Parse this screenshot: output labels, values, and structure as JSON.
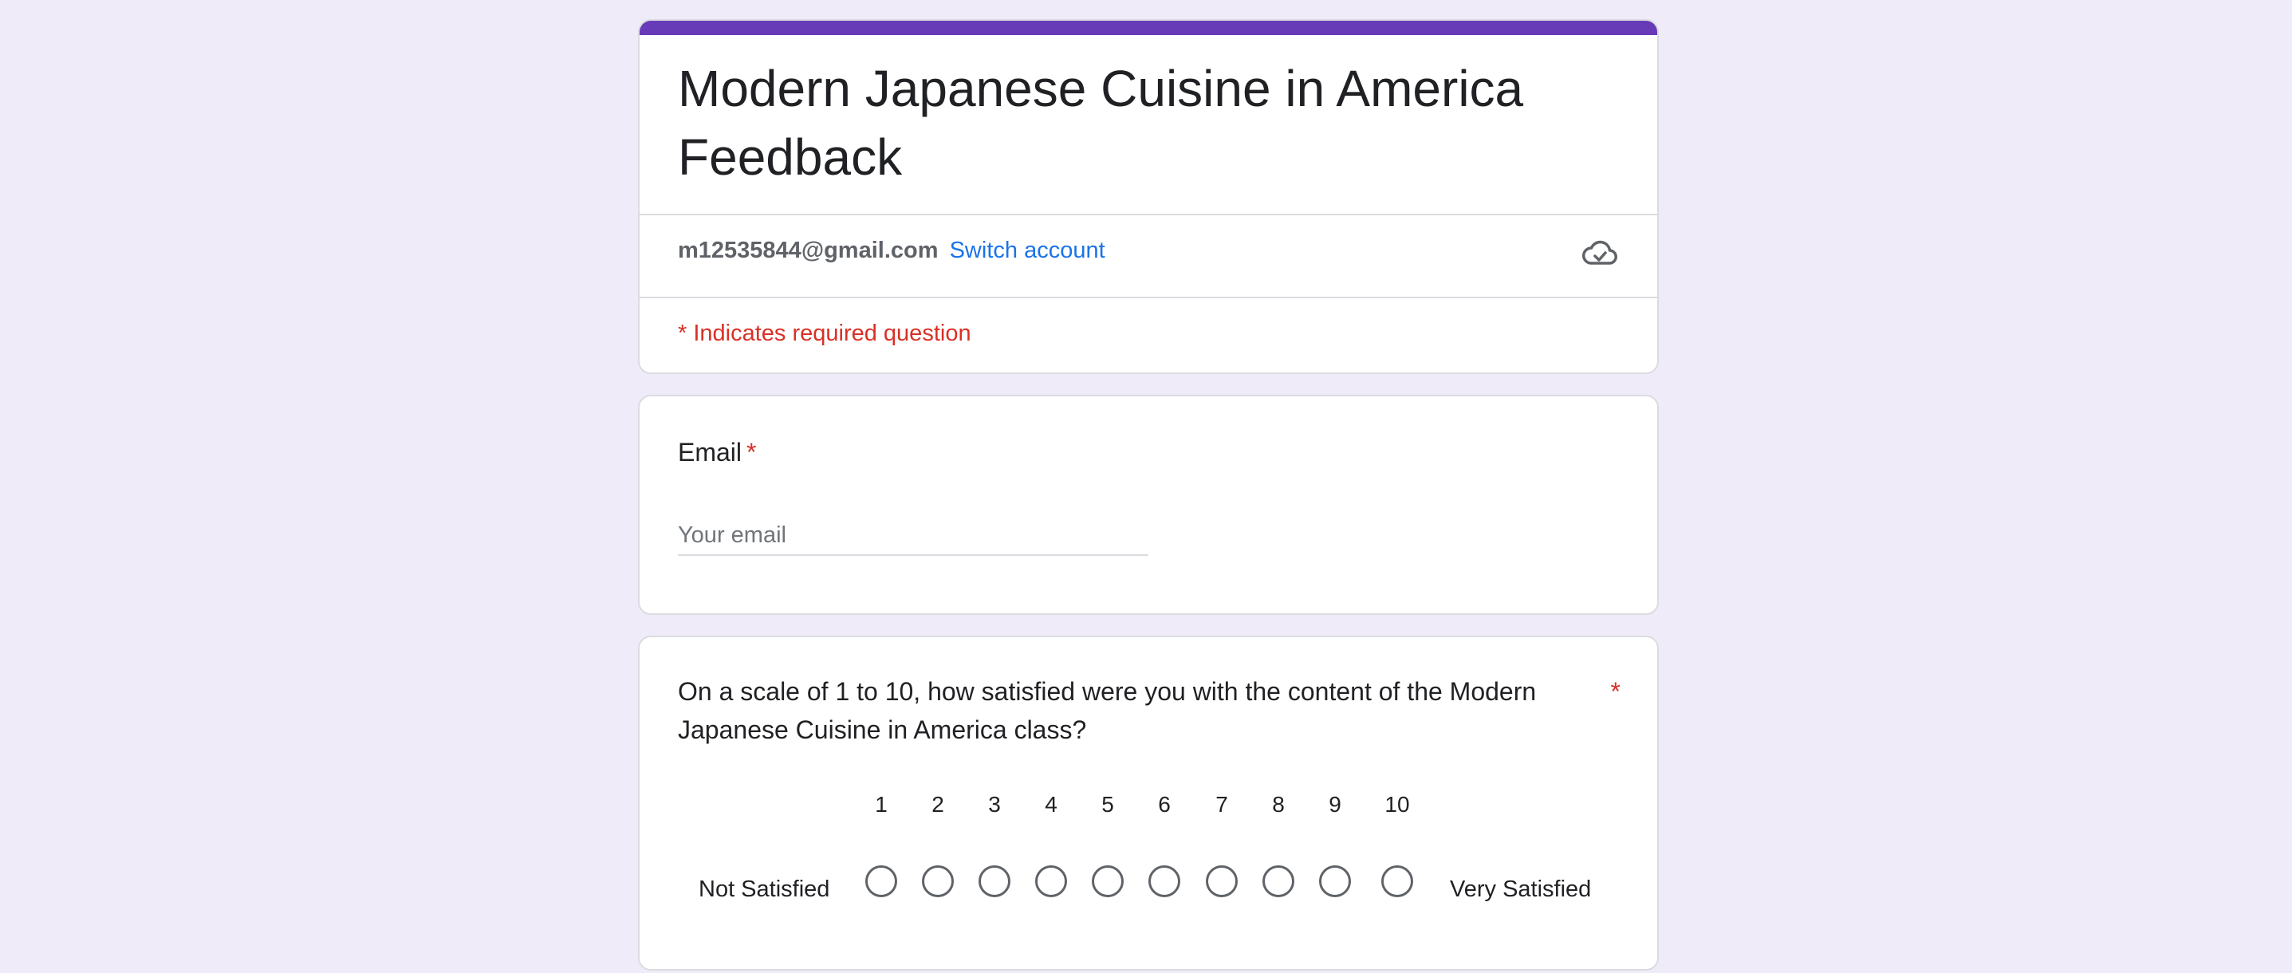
{
  "form": {
    "title": "Modern Japanese Cuisine in America Feedback",
    "accent_color": "#673ab7"
  },
  "account": {
    "email": "m12535844@gmail.com",
    "switch_label": "Switch account",
    "status_icon": "cloud-check-icon"
  },
  "required_note": "* Indicates required question",
  "email_question": {
    "label": "Email",
    "required_mark": "*",
    "placeholder": "Your email",
    "value": ""
  },
  "scale_question": {
    "text": "On a scale of 1 to 10, how satisfied were you with the content of the Modern Japanese Cuisine in America class?",
    "required_mark": "*",
    "low_label": "Not Satisfied",
    "high_label": "Very Satisfied",
    "options": [
      "1",
      "2",
      "3",
      "4",
      "5",
      "6",
      "7",
      "8",
      "9",
      "10"
    ]
  }
}
